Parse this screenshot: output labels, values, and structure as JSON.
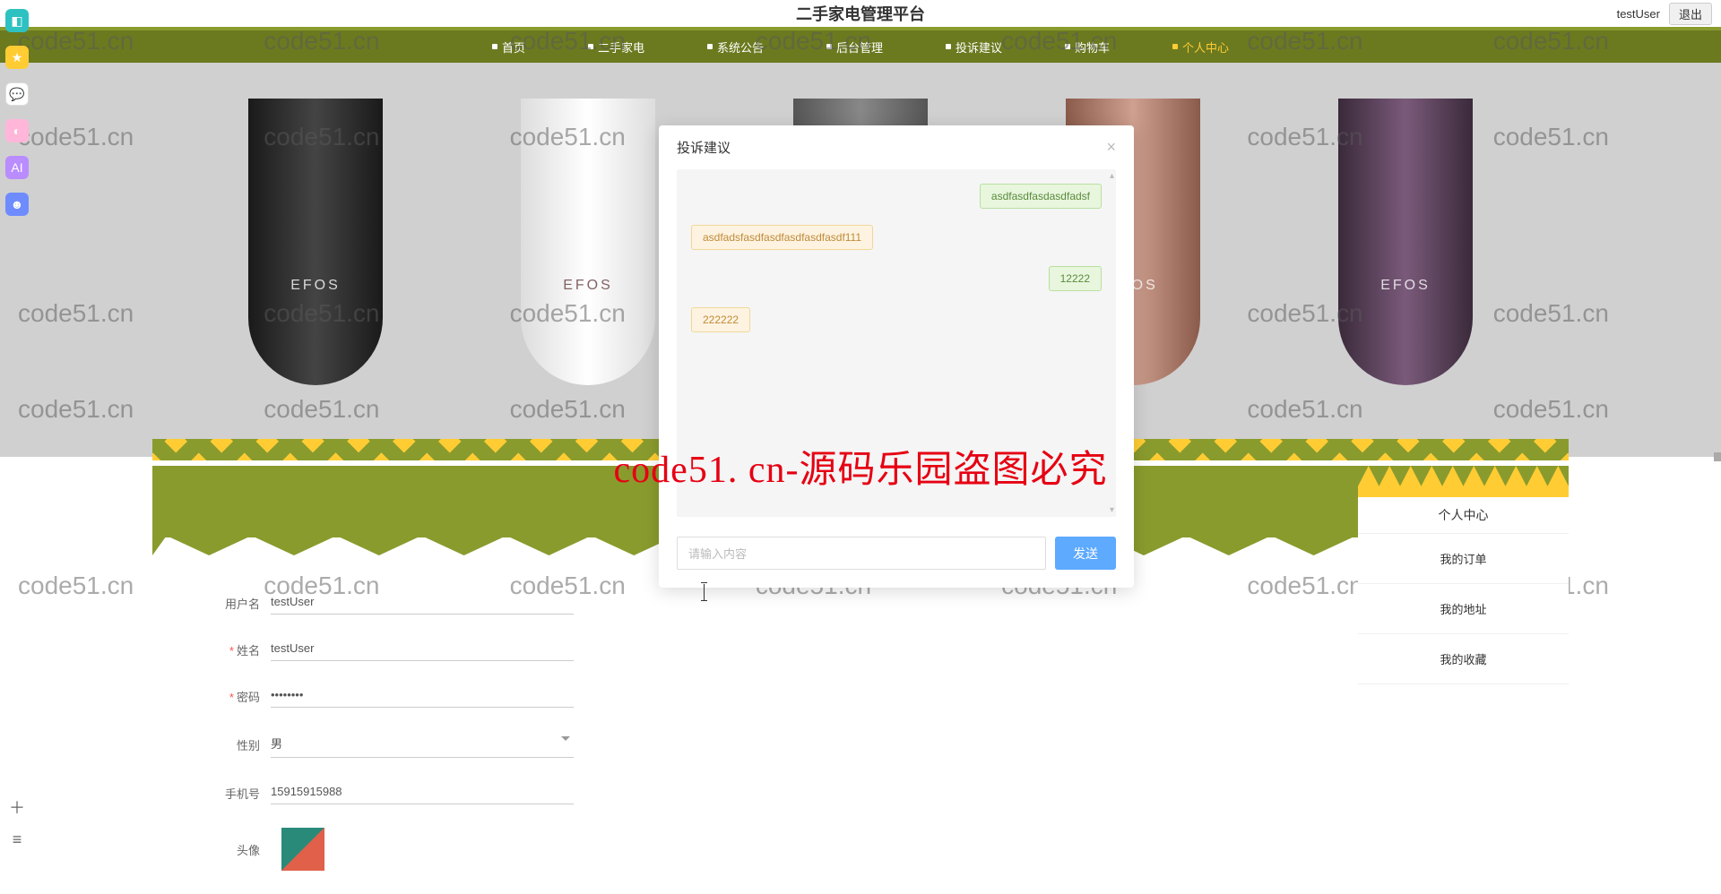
{
  "watermark_text": "code51.cn",
  "big_red_text": "code51. cn-源码乐园盗图必究",
  "header": {
    "title": "二手家电管理平台",
    "username": "testUser",
    "logout": "退出"
  },
  "nav": {
    "items": [
      {
        "label": "首页",
        "active": false
      },
      {
        "label": "二手家电",
        "active": false
      },
      {
        "label": "系统公告",
        "active": false
      },
      {
        "label": "后台管理",
        "active": false
      },
      {
        "label": "投诉建议",
        "active": false
      },
      {
        "label": "购物车",
        "active": false
      },
      {
        "label": "个人中心",
        "active": true
      }
    ]
  },
  "hero": {
    "brand_text": "EFOS"
  },
  "personal": {
    "title": "个人中心",
    "items": [
      "我的订单",
      "我的地址",
      "我的收藏"
    ]
  },
  "form": {
    "fields": [
      {
        "label": "用户名",
        "required": false,
        "value": "testUser",
        "type": "text"
      },
      {
        "label": "姓名",
        "required": true,
        "value": "testUser",
        "type": "text"
      },
      {
        "label": "密码",
        "required": true,
        "value": "••••••••",
        "type": "password"
      },
      {
        "label": "性别",
        "required": false,
        "value": "男",
        "type": "select"
      },
      {
        "label": "手机号",
        "required": false,
        "value": "15915915988",
        "type": "text"
      },
      {
        "label": "头像",
        "required": false,
        "value": "",
        "type": "avatar"
      }
    ]
  },
  "modal": {
    "title": "投诉建议",
    "messages": [
      {
        "side": "right",
        "text": "asdfasdfasdasdfadsf"
      },
      {
        "side": "left",
        "text": "asdfadsfasdfasdfasdfasdfasdf111"
      },
      {
        "side": "right",
        "text": "12222"
      },
      {
        "side": "left",
        "text": "222222"
      }
    ],
    "input_placeholder": "请输入内容",
    "send_label": "发送"
  }
}
